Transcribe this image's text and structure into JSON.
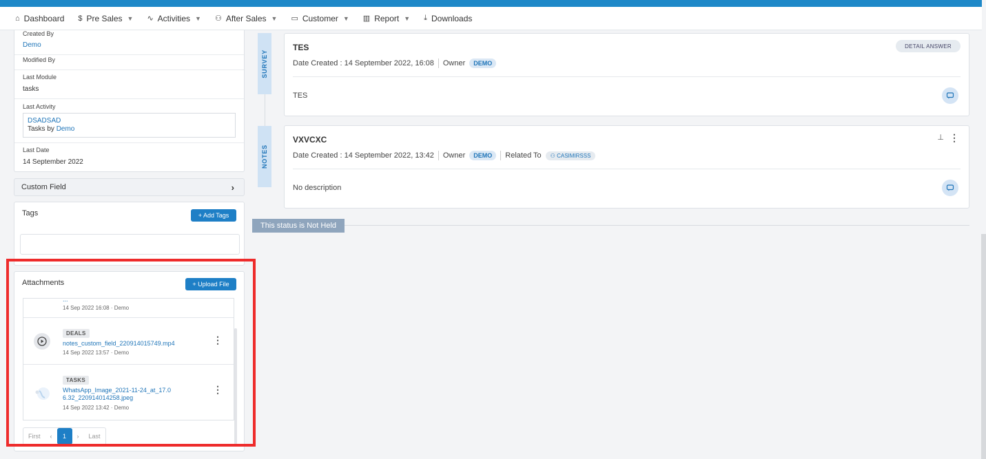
{
  "nav": {
    "items": [
      {
        "label": "Dashboard",
        "icon": "home-icon",
        "glyph": "⌂",
        "chevron": false
      },
      {
        "label": "Pre Sales",
        "icon": "dollar-icon",
        "glyph": "$",
        "chevron": true
      },
      {
        "label": "Activities",
        "icon": "activity-icon",
        "glyph": "∿",
        "chevron": true
      },
      {
        "label": "After Sales",
        "icon": "users-icon",
        "glyph": "⚇",
        "chevron": true
      },
      {
        "label": "Customer",
        "icon": "folder-icon",
        "glyph": "▭",
        "chevron": true
      },
      {
        "label": "Report",
        "icon": "bar-chart-icon",
        "glyph": "▥",
        "chevron": true
      },
      {
        "label": "Downloads",
        "icon": "download-icon",
        "glyph": "⤓",
        "chevron": false
      }
    ]
  },
  "info": {
    "created_by_label": "Created By",
    "created_by_value": "Demo",
    "modified_by_label": "Modified By",
    "last_module_label": "Last Module",
    "last_module_value": "tasks",
    "last_activity_label": "Last Activity",
    "last_activity_title": "DSADSAD",
    "last_activity_prefix": "Tasks by",
    "last_activity_user": "Demo",
    "last_date_label": "Last Date",
    "last_date_value": "14 September 2022"
  },
  "custom_field": {
    "label": "Custom Field"
  },
  "tags": {
    "title": "Tags",
    "add_label": "+ Add Tags"
  },
  "attachments": {
    "title": "Attachments",
    "upload_label": "+ Upload File",
    "items": [
      {
        "badge": "",
        "name": "...",
        "meta": "14 Sep 2022 16:08 · Demo"
      },
      {
        "badge": "DEALS",
        "name": "notes_custom_field_220914015749.mp4",
        "meta": "14 Sep 2022 13:57 · Demo"
      },
      {
        "badge": "TASKS",
        "name": "WhatsApp_Image_2021-11-24_at_17.06.32_220914014258.jpeg",
        "meta": "14 Sep 2022 13:42 · Demo"
      }
    ],
    "pager": {
      "first": "First",
      "prev": "‹",
      "page": "1",
      "next": "›",
      "last": "Last"
    }
  },
  "timeline": {
    "survey_tab": "SURVEY",
    "notes_tab": "NOTES",
    "survey_card": {
      "title": "TES",
      "detail_label": "DETAIL ANSWER",
      "date_label": "Date Created :",
      "date_value": "14 September 2022, 16:08",
      "owner_label": "Owner",
      "owner_value": "DEMO",
      "description": "TES"
    },
    "notes_card": {
      "title": "VXVCXC",
      "date_label": "Date Created :",
      "date_value": "14 September 2022, 13:42",
      "owner_label": "Owner",
      "owner_value": "DEMO",
      "related_label": "Related To",
      "related_value": "CASIMIRSSS",
      "description": "No description"
    },
    "status_text": "This status is Not Held"
  },
  "colors": {
    "accent": "#1e7fc6",
    "highlight": "#ee2b2b",
    "top_bar": "#1e88c8"
  }
}
